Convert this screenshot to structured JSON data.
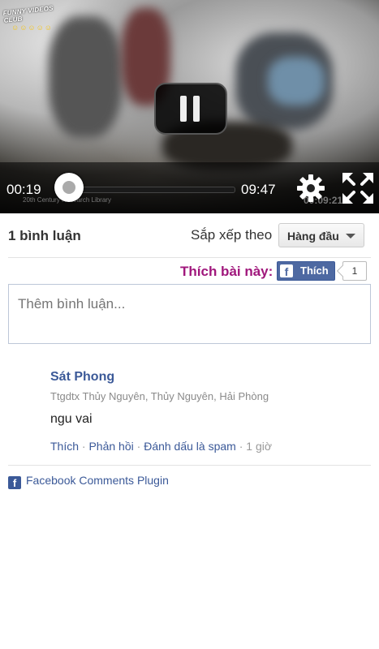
{
  "player": {
    "logo_text": "FUNNY VIDEOS CLUB",
    "logo_faces": "☺☺☺☺☺",
    "watermark": "20th Century Research Library",
    "watermark_time": "00:09:21",
    "current_time": "00:19",
    "duration": "09:47",
    "progress": 0.032,
    "state": "playing",
    "icons": {
      "pause": "pause-icon",
      "settings": "gear-icon",
      "fullscreen": "expand-icon"
    }
  },
  "comments_header": {
    "count_label": "1 bình luận",
    "sort_label": "Sắp xếp theo",
    "sort_value": "Hàng đầu"
  },
  "like_bar": {
    "prompt": "Thích bài này:",
    "button_label": "Thích",
    "count": "1"
  },
  "compose": {
    "placeholder": "Thêm bình luận..."
  },
  "comments": [
    {
      "author": "Sát Phong",
      "location": "Ttgdtx Thủy Nguyên, Thủy Nguyên, Hải Phòng",
      "text": "ngu vai",
      "actions": {
        "like": "Thích",
        "reply": "Phản hồi",
        "spam": "Đánh dấu là spam",
        "age": "1 giờ"
      }
    }
  ],
  "footer": {
    "label": "Facebook Comments Plugin"
  },
  "colors": {
    "facebook_blue": "#3b5998",
    "like_prompt": "#a0177c",
    "progress_red": "#cc0000"
  }
}
